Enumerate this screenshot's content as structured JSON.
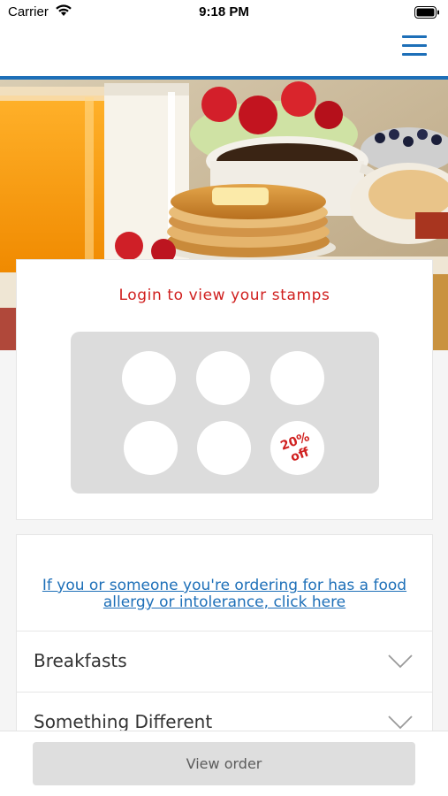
{
  "status_bar": {
    "carrier": "Carrier",
    "time": "9:18 PM"
  },
  "stamps": {
    "title": "Login to view your stamps",
    "reward_text_line1": "20%",
    "reward_text_line2": "off",
    "total": 6,
    "collected": 0
  },
  "allergy": {
    "link_line1": "If you or someone you're ordering for has a food",
    "link_line2": "allergy or intolerance, click here"
  },
  "categories": [
    {
      "label": "Breakfasts"
    },
    {
      "label": "Something Different"
    }
  ],
  "bottom": {
    "view_order_label": "View order"
  },
  "colors": {
    "accent_blue": "#1d6fb8",
    "stamp_red": "#d0201f",
    "panel_gray": "#dcdcdc"
  }
}
